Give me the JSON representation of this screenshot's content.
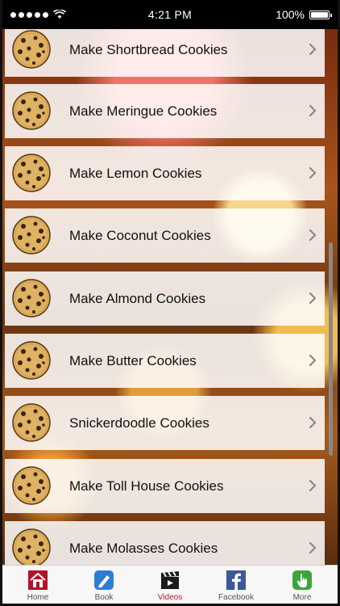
{
  "status_bar": {
    "time": "4:21 PM",
    "battery": "100%"
  },
  "items": [
    {
      "label": "Make Shortbread Cookies"
    },
    {
      "label": "Make Meringue Cookies"
    },
    {
      "label": "Make Lemon Cookies"
    },
    {
      "label": "Make Coconut Cookies"
    },
    {
      "label": "Make Almond Cookies"
    },
    {
      "label": "Make Butter Cookies"
    },
    {
      "label": "Snickerdoodle Cookies"
    },
    {
      "label": "Make Toll House Cookies"
    },
    {
      "label": "Make Molasses Cookies"
    }
  ],
  "tabs": [
    {
      "label": "Home",
      "icon": "home-icon"
    },
    {
      "label": "Book",
      "icon": "book-icon"
    },
    {
      "label": "Videos",
      "icon": "videos-icon",
      "active": true
    },
    {
      "label": "Facebook",
      "icon": "facebook-icon"
    },
    {
      "label": "More",
      "icon": "more-icon"
    }
  ],
  "colors": {
    "accent": "#c4122d",
    "row_bg": "#ffffff",
    "stripe": "#8a4a17"
  }
}
